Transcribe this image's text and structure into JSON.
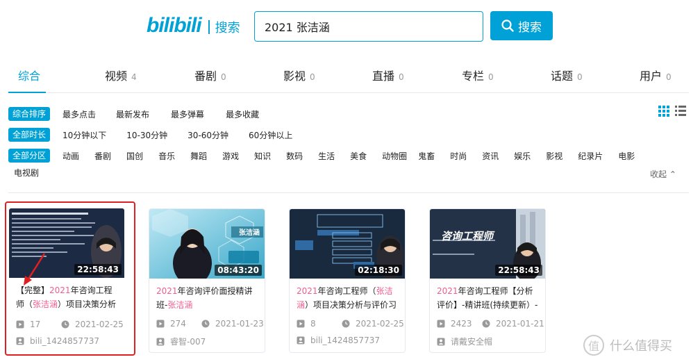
{
  "header": {
    "logo_text": "bilibili",
    "logo_suffix": "搜索",
    "search_value": "2021 张洁涵",
    "search_button": "搜索"
  },
  "tabs": [
    {
      "label": "综合",
      "count": ""
    },
    {
      "label": "视频",
      "count": "4"
    },
    {
      "label": "番剧",
      "count": "0"
    },
    {
      "label": "影视",
      "count": "0"
    },
    {
      "label": "直播",
      "count": "0"
    },
    {
      "label": "专栏",
      "count": "0"
    },
    {
      "label": "话题",
      "count": "0"
    },
    {
      "label": "用户",
      "count": "0"
    }
  ],
  "filters": {
    "sort": {
      "label": "综合排序",
      "options": [
        "最多点击",
        "最新发布",
        "最多弹幕",
        "最多收藏"
      ]
    },
    "duration": {
      "label": "全部时长",
      "options": [
        "10分钟以下",
        "10-30分钟",
        "30-60分钟",
        "60分钟以上"
      ]
    },
    "zone": {
      "label": "全部分区",
      "options": [
        "动画",
        "番剧",
        "国创",
        "音乐",
        "舞蹈",
        "游戏",
        "知识",
        "数码",
        "生活",
        "美食",
        "动物圈",
        "鬼畜",
        "时尚",
        "资讯",
        "娱乐",
        "影视",
        "纪录片",
        "电影"
      ],
      "overflow": "电视剧"
    },
    "collapse_label": "收起"
  },
  "videos": [
    {
      "duration": "22:58:43",
      "title_pre": "【完整】",
      "title_hl1": "2021",
      "title_mid": "年咨询工程师（",
      "title_hl2": "张洁涵",
      "title_post": "）项目决策分析与",
      "plays": "17",
      "date": "2021-02-25",
      "uploader": "bili_1424857737"
    },
    {
      "duration": "08:43:20",
      "title_pre": "",
      "title_hl1": "2021",
      "title_mid": "年咨询评价面授精讲班-",
      "title_hl2": "张洁涵",
      "title_post": "",
      "plays": "274",
      "date": "2021-01-23",
      "uploader": "睿智-007"
    },
    {
      "duration": "02:18:30",
      "title_pre": "",
      "title_hl1": "2021",
      "title_mid": "年咨询工程师（",
      "title_hl2": "张洁涵",
      "title_post": "）项目决策分析与评价习",
      "plays": "8",
      "date": "2021-02-25",
      "uploader": "bili_1424857737"
    },
    {
      "duration": "22:58:43",
      "title_pre": "",
      "title_hl1": "2021",
      "title_mid": "年咨询工程师【分析评价】-精讲班(持续更新）-张",
      "title_hl2": "",
      "title_post": "",
      "plays": "2423",
      "date": "2021-01-21",
      "uploader": "请戴安全帽"
    }
  ],
  "thumb_texts": {
    "v2_name": "张洁涵",
    "v4_title": "咨询工程师"
  },
  "watermark": {
    "glyph": "值",
    "text": "什么值得买"
  },
  "colors": {
    "accent": "#00a1d6",
    "highlight": "#f25d8e",
    "annotation": "#e02020"
  }
}
